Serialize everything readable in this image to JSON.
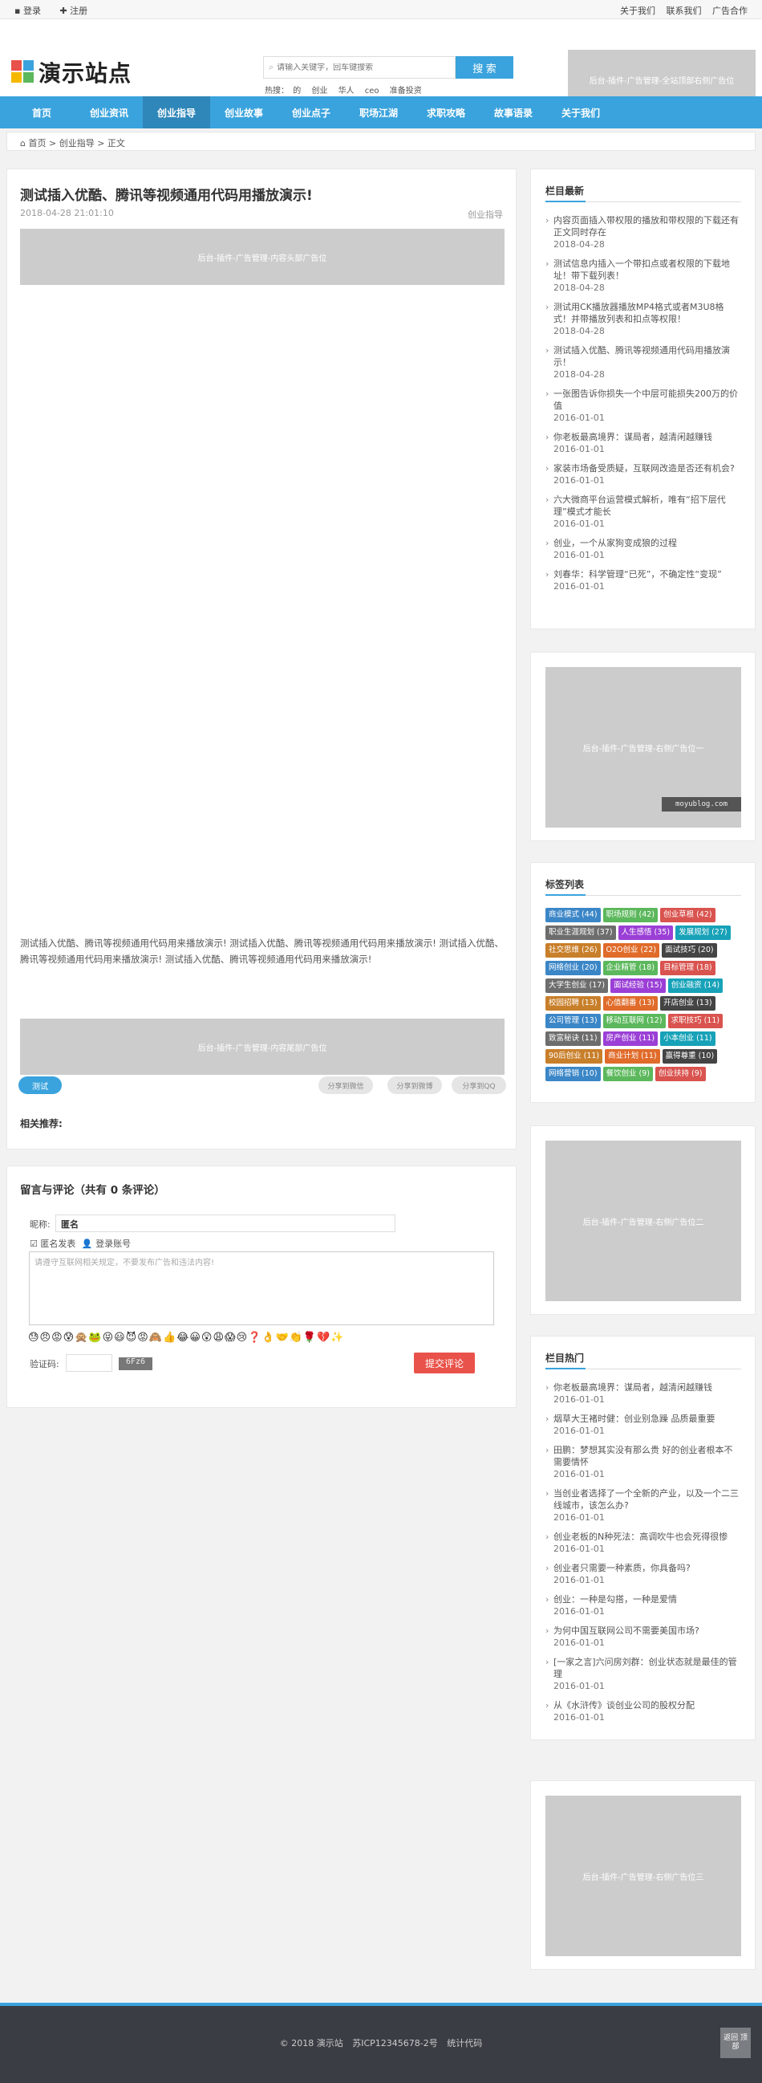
{
  "topbar": {
    "login": "登录",
    "register": "注册",
    "links": [
      "关于我们",
      "联系我们",
      "广告合作"
    ]
  },
  "header": {
    "logo_text": "演示站点",
    "search_placeholder": "请输入关键字，回车键搜索",
    "search_button": "搜 索",
    "hot_label": "热搜：",
    "hot_terms": [
      "的",
      "创业",
      "华人",
      "ceo",
      "准备投资"
    ],
    "ad_text": "后台-插件-广告管理-全站顶部右侧广告位"
  },
  "nav": {
    "items": [
      "首页",
      "创业资讯",
      "创业指导",
      "创业故事",
      "创业点子",
      "职场江湖",
      "求职攻略",
      "故事语录",
      "关于我们"
    ],
    "active_index": 2
  },
  "breadcrumb": {
    "home": "首页",
    "sep1": ">",
    "section": "创业指导",
    "sep2": ">",
    "current": "正文"
  },
  "article": {
    "title": "测试插入优酷、腾讯等视频通用代码用播放演示!",
    "datetime": "2018-04-28 21:01:10",
    "category": "创业指导",
    "ad_top": "后台-插件-广告管理-内容头部广告位",
    "body": "测试插入优酷、腾讯等视频通用代码用来播放演示! 测试插入优酷、腾讯等视频通用代码用来播放演示! 测试插入优酷、腾讯等视频通用代码用来播放演示! 测试插入优酷、腾讯等视频通用代码用来播放演示!",
    "ad_bottom": "后台-插件-广告管理-内容尾部广告位",
    "tag": "测试",
    "share": [
      "分享到微信",
      "分享到微博",
      "分享到QQ"
    ],
    "related_label": "相关推荐:"
  },
  "comments": {
    "title": "留言与评论（共有 0 条评论）",
    "name_label": "昵称:",
    "name_value": "匿名",
    "anon_label": "匿名发表",
    "login_label": "登录账号",
    "textarea_placeholder": "请遵守互联网相关规定，不要发布广告和违法内容!",
    "emojis": "😓😠😡😰🙊🐸😝😃😈😡🙈👍😂😀😲😩😱😢❓👌🤝👏🌹💔✨",
    "captcha_label": "验证码:",
    "captcha_code": "6Fz6",
    "submit": "提交评论"
  },
  "sidebar": {
    "latest_title": "栏目最新",
    "latest": [
      {
        "title": "内容页面插入带权限的播放和带权限的下载还有正文同时存在",
        "date": "2018-04-28"
      },
      {
        "title": "测试信息内插入一个带扣点或者权限的下载地址！带下载列表！",
        "date": "2018-04-28"
      },
      {
        "title": "测试用CK播放器播放MP4格式或者M3U8格式！并带播放列表和扣点等权限！",
        "date": "2018-04-28"
      },
      {
        "title": "测试插入优酷、腾讯等视频通用代码用播放演示！",
        "date": "2018-04-28"
      },
      {
        "title": "一张图告诉你损失一个中层可能损失200万的价值",
        "date": "2016-01-01"
      },
      {
        "title": "你老板最高境界：谋局者，越清闲越赚钱",
        "date": "2016-01-01"
      },
      {
        "title": "家装市场备受质疑，互联网改造是否还有机会?",
        "date": "2016-01-01"
      },
      {
        "title": "六大微商平台运营模式解析，唯有“招下层代理”模式才能长",
        "date": "2016-01-01"
      },
      {
        "title": "创业，一个从家狗变成狼的过程",
        "date": "2016-01-01"
      },
      {
        "title": "刘春华：科学管理“已死”，不确定性“变现”",
        "date": "2016-01-01"
      }
    ],
    "ad1": "后台-插件-广告管理-右侧广告位一",
    "ad1_watermark": "moyublog.com",
    "tags_title": "标签列表",
    "tags": [
      {
        "t": "商业模式 (44)",
        "c": "#3b86c7"
      },
      {
        "t": "职场规则 (42)",
        "c": "#5cb85c"
      },
      {
        "t": "创业草根 (42)",
        "c": "#d9534f"
      },
      {
        "t": "职业生涯规划 (37)",
        "c": "#6d6d6d"
      },
      {
        "t": "人生感悟 (35)",
        "c": "#9b3fd6"
      },
      {
        "t": "发展规划 (27)",
        "c": "#17a2b8"
      },
      {
        "t": "社交思维 (26)",
        "c": "#c87f2a"
      },
      {
        "t": "O2O创业 (22)",
        "c": "#e06b2a"
      },
      {
        "t": "面试技巧 (20)",
        "c": "#444444"
      },
      {
        "t": "网络创业 (20)",
        "c": "#3b86c7"
      },
      {
        "t": "企业精管 (18)",
        "c": "#5cb85c"
      },
      {
        "t": "目标管理 (18)",
        "c": "#d9534f"
      },
      {
        "t": "大学生创业 (17)",
        "c": "#6d6d6d"
      },
      {
        "t": "面试经验 (15)",
        "c": "#9b3fd6"
      },
      {
        "t": "创业融资 (14)",
        "c": "#17a2b8"
      },
      {
        "t": "校园招聘 (13)",
        "c": "#c87f2a"
      },
      {
        "t": "心值翻番 (13)",
        "c": "#e06b2a"
      },
      {
        "t": "开店创业 (13)",
        "c": "#444444"
      },
      {
        "t": "公司管理 (13)",
        "c": "#3b86c7"
      },
      {
        "t": "移动互联网 (12)",
        "c": "#5cb85c"
      },
      {
        "t": "求职技巧 (11)",
        "c": "#d9534f"
      },
      {
        "t": "致富秘诀 (11)",
        "c": "#6d6d6d"
      },
      {
        "t": "房产创业 (11)",
        "c": "#9b3fd6"
      },
      {
        "t": "小本创业 (11)",
        "c": "#17a2b8"
      },
      {
        "t": "90后创业 (11)",
        "c": "#c87f2a"
      },
      {
        "t": "商业计划 (11)",
        "c": "#e06b2a"
      },
      {
        "t": "赢得尊重 (10)",
        "c": "#444444"
      },
      {
        "t": "网络营销 (10)",
        "c": "#3b86c7"
      },
      {
        "t": "餐饮创业 (9)",
        "c": "#5cb85c"
      },
      {
        "t": "创业扶持 (9)",
        "c": "#d9534f"
      }
    ],
    "ad2": "后台-插件-广告管理-右侧广告位二",
    "hot_title": "栏目热门",
    "hot": [
      {
        "title": "你老板最高境界：谋局者，越清闲越赚钱",
        "date": "2016-01-01"
      },
      {
        "title": "烟草大王褚时健：创业别急躁 品质最重要",
        "date": "2016-01-01"
      },
      {
        "title": "田鹏：梦想其实没有那么贵 好的创业者根本不需要情怀",
        "date": "2016-01-01"
      },
      {
        "title": "当创业者选择了一个全新的产业，以及一个二三线城市，该怎么办?",
        "date": "2016-01-01"
      },
      {
        "title": "创业老板的N种死法：高调吹牛也会死得很惨",
        "date": "2016-01-01"
      },
      {
        "title": "创业者只需要一种素质，你具备吗?",
        "date": "2016-01-01"
      },
      {
        "title": "创业：一种是勾搭，一种是爱情",
        "date": "2016-01-01"
      },
      {
        "title": "为何中国互联网公司不需要美国市场?",
        "date": "2016-01-01"
      },
      {
        "title": "[一家之言]六问房刘群：创业状态就是最佳的管理",
        "date": "2016-01-01"
      },
      {
        "title": "从《水浒传》谈创业公司的股权分配",
        "date": "2016-01-01"
      }
    ],
    "ad3": "后台-插件-广告管理-右侧广告位三"
  },
  "footer": {
    "copyright": "© 2018 演示站",
    "icp": "苏ICP12345678-2号",
    "stats": "统计代码",
    "back_to_top": "返回 顶部"
  },
  "colors": {
    "accent": "#3aa3dd",
    "nav_active": "#2f86b8",
    "submit": "#e9524a",
    "footer": "#3a3d44"
  }
}
